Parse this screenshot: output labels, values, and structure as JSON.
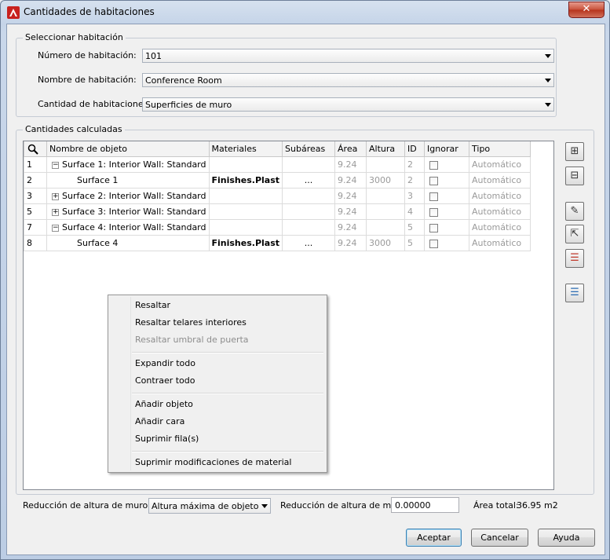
{
  "window": {
    "title": "Cantidades de habitaciones",
    "close_label": "✕"
  },
  "select_room": {
    "group_label": "Seleccionar habitación",
    "room_number_label": "Número de habitación:",
    "room_number_value": "101",
    "room_name_label": "Nombre de habitación:",
    "room_name_value": "Conference Room",
    "room_quantity_label": "Cantidad de habitaciones:",
    "room_quantity_value": "Superficies de muro"
  },
  "calculated": {
    "group_label": "Cantidades calculadas",
    "columns": [
      "Nombre de objeto",
      "Materiales",
      "Subáreas",
      "Área",
      "Altura",
      "ID",
      "Ignorar",
      "Tipo"
    ],
    "rows": [
      {
        "num": "1",
        "expander": "−",
        "indent": false,
        "name": "Surface 1: Interior Wall: Standard",
        "material": "",
        "subareas": "",
        "area": "9.24",
        "height": "",
        "id": "2",
        "type": "Automático"
      },
      {
        "num": "2",
        "expander": "",
        "indent": true,
        "name": "Surface 1",
        "material": "Finishes.Plast",
        "subareas": "...",
        "area": "9.24",
        "height": "3000",
        "id": "2",
        "type": "Automático"
      },
      {
        "num": "3",
        "expander": "+",
        "indent": false,
        "name": "Surface 2: Interior Wall: Standard",
        "material": "",
        "subareas": "",
        "area": "9.24",
        "height": "",
        "id": "3",
        "type": "Automático"
      },
      {
        "num": "5",
        "expander": "+",
        "indent": false,
        "name": "Surface 3: Interior Wall: Standard",
        "material": "",
        "subareas": "",
        "area": "9.24",
        "height": "",
        "id": "4",
        "type": "Automático"
      },
      {
        "num": "7",
        "expander": "−",
        "indent": false,
        "name": "Surface 4: Interior Wall: Standard",
        "material": "",
        "subareas": "",
        "area": "9.24",
        "height": "",
        "id": "5",
        "type": "Automático"
      },
      {
        "num": "8",
        "expander": "",
        "indent": true,
        "name": "Surface 4",
        "material": "Finishes.Plast",
        "subareas": "...",
        "area": "9.24",
        "height": "3000",
        "id": "5",
        "type": "Automático"
      }
    ]
  },
  "side_buttons": [
    {
      "icon": "expand-all-icon",
      "glyph": "⊞"
    },
    {
      "icon": "collapse-all-icon",
      "glyph": "⊟"
    },
    {
      "icon": "highlight-icon",
      "glyph": "✎"
    },
    {
      "icon": "select-object-icon",
      "glyph": "⇱"
    },
    {
      "icon": "delete-row-icon",
      "glyph": "☰"
    },
    {
      "icon": "add-row-icon",
      "glyph": "☰"
    }
  ],
  "context_menu": {
    "items": [
      {
        "label": "Resaltar",
        "enabled": true
      },
      {
        "label": "Resaltar telares interiores",
        "enabled": true
      },
      {
        "label": "Resaltar umbral de puerta",
        "enabled": false
      },
      {
        "label": "Expandir todo",
        "enabled": true
      },
      {
        "label": "Contraer todo",
        "enabled": true
      },
      {
        "label": "Añadir objeto",
        "enabled": true
      },
      {
        "label": "Añadir cara",
        "enabled": true
      },
      {
        "label": "Suprimir fila(s)",
        "enabled": true
      },
      {
        "label": "Suprimir modificaciones de material",
        "enabled": true
      }
    ]
  },
  "footer": {
    "reduction_by_label": "Reducción de altura de muro de",
    "reduction_by_value": "Altura máxima de objeto",
    "reduction_label": "Reducción de altura de muro",
    "reduction_value": "0.00000",
    "total_area_label": "Área total:",
    "total_area_value": "36.95 m2",
    "ok_label": "Aceptar",
    "cancel_label": "Cancelar",
    "help_label": "Ayuda"
  }
}
